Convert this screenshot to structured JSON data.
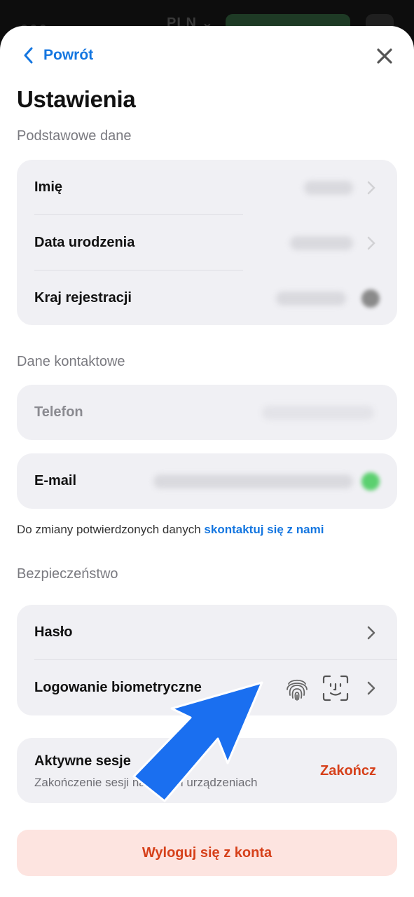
{
  "background": {
    "currency": "PLN",
    "currency_chevron": "chevron-down-icon"
  },
  "nav": {
    "back_label": "Powrót",
    "back_icon": "chevron-left-icon",
    "close_icon": "close-icon"
  },
  "page_title": "Ustawienia",
  "basic": {
    "section_title": "Podstawowe dane",
    "items": [
      {
        "label": "Imię"
      },
      {
        "label": "Data urodzenia"
      },
      {
        "label": "Kraj rejestracji"
      }
    ]
  },
  "contact": {
    "section_title": "Dane kontaktowe",
    "phone_label": "Telefon",
    "email_label": "E-mail",
    "hint_text": "Do zmiany potwierdzonych danych ",
    "hint_link": "skontaktuj się z nami"
  },
  "security": {
    "section_title": "Bezpieczeństwo",
    "password_label": "Hasło",
    "biometric_label": "Logowanie biometryczne",
    "biometric_icons": [
      "fingerprint-icon",
      "face-id-icon"
    ]
  },
  "sessions": {
    "title": "Aktywne sesje",
    "subtitle": "Zakończenie sesji na innych urządzeniach",
    "action_label": "Zakończ"
  },
  "logout_label": "Wyloguj się z konta",
  "colors": {
    "accent": "#1476e0",
    "danger": "#d6401a",
    "danger_bg": "#fde4e0",
    "card_bg": "#f0f0f4",
    "arrow": "#1a6ff0"
  }
}
